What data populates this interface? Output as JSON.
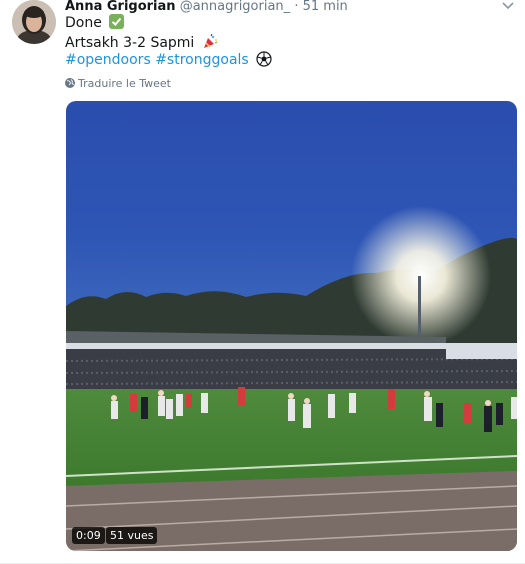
{
  "tweet": {
    "author_name": "Anna Grigorian",
    "handle": "@annagrigorian_",
    "separator": "·",
    "time": "51 min",
    "lines": {
      "line1": "Done",
      "line2": "Artsakh 3-2 Sapmi",
      "hashtag1": "#opendoors",
      "hashtag2": "#stronggoals"
    },
    "translate_label": "Traduire le Tweet"
  },
  "video": {
    "duration": "0:09",
    "views": "51 vues"
  },
  "icons": {
    "check": "white-heavy-check-mark-icon",
    "party": "party-popper-icon",
    "ball": "soccer-ball-icon",
    "globe": "globe-icon",
    "caret": "chevron-down-icon"
  },
  "colors": {
    "link": "#1b95e0",
    "text": "#14171a",
    "secondary": "#657786",
    "check_green": "#78b159"
  }
}
